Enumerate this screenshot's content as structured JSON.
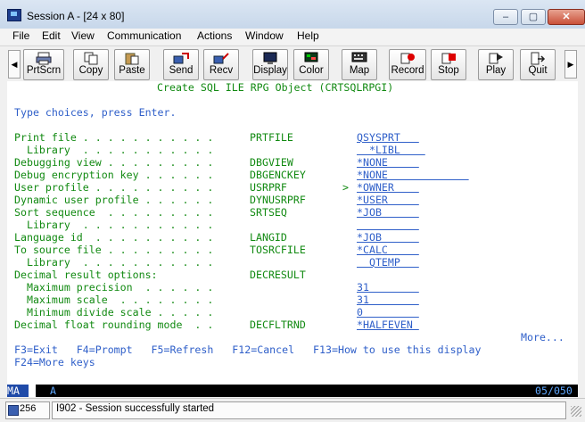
{
  "window": {
    "title": "Session A - [24 x 80]",
    "controls": [
      "–",
      "▢",
      "✕"
    ]
  },
  "menus": [
    "File",
    "Edit",
    "View",
    "Communication",
    "Actions",
    "Window",
    "Help"
  ],
  "toolbar": {
    "buttons": [
      {
        "label": "PrtScrn",
        "icon": "printer-icon"
      },
      {
        "label": "Copy",
        "icon": "copy-icon"
      },
      {
        "label": "Paste",
        "icon": "paste-icon"
      },
      {
        "label": "Send",
        "icon": "send-icon"
      },
      {
        "label": "Recv",
        "icon": "receive-icon"
      },
      {
        "label": "Display",
        "icon": "display-icon"
      },
      {
        "label": "Color",
        "icon": "color-icon"
      },
      {
        "label": "Map",
        "icon": "map-icon"
      },
      {
        "label": "Record",
        "icon": "record-icon"
      },
      {
        "label": "Stop",
        "icon": "stop-icon"
      },
      {
        "label": "Play",
        "icon": "play-icon"
      },
      {
        "label": "Quit",
        "icon": "quit-icon"
      }
    ],
    "scroll_left": "◀",
    "scroll_right": "▶"
  },
  "screen": {
    "header": "Create SQL ILE RPG Object (CRTSQLRPGI)",
    "instructions": "Type choices, press Enter.",
    "rows": [
      {
        "label": "Print file . . . . . . . . . . .",
        "keyword": "PRTFILE",
        "value": "QSYSPRT   "
      },
      {
        "label": "  Library  . . . . . . . . . . .",
        "keyword": "",
        "value": "  *LIBL    "
      },
      {
        "label": "Debugging view . . . . . . . . .",
        "keyword": "DBGVIEW",
        "value": "*NONE     "
      },
      {
        "label": "Debug encryption key . . . . . .",
        "keyword": "DBGENCKEY",
        "value": "*NONE             "
      },
      {
        "label": "User profile . . . . . . . . . .",
        "keyword": "USRPRF",
        "value": "*OWNER    ",
        "marker": ">"
      },
      {
        "label": "Dynamic user profile . . . . . .",
        "keyword": "DYNUSRPRF",
        "value": "*USER     "
      },
      {
        "label": "Sort sequence  . . . . . . . . .",
        "keyword": "SRTSEQ",
        "value": "*JOB      "
      },
      {
        "label": "  Library  . . . . . . . . . . .",
        "keyword": "",
        "value": "          "
      },
      {
        "label": "Language id  . . . . . . . . . .",
        "keyword": "LANGID",
        "value": "*JOB      "
      },
      {
        "label": "To source file . . . . . . . . .",
        "keyword": "TOSRCFILE",
        "value": "*CALC     "
      },
      {
        "label": "  Library  . . . . . . . . . . .",
        "keyword": "",
        "value": "  QTEMP   "
      },
      {
        "label": "Decimal result options:",
        "keyword": "DECRESULT",
        "value": ""
      },
      {
        "label": "  Maximum precision  . . . . . .",
        "keyword": "",
        "value": "31        "
      },
      {
        "label": "  Maximum scale  . . . . . . . .",
        "keyword": "",
        "value": "31        "
      },
      {
        "label": "  Minimum divide scale . . . . .",
        "keyword": "",
        "value": "0         "
      },
      {
        "label": "Decimal float rounding mode  . .",
        "keyword": "DECFLTRND",
        "value": "*HALFEVEN "
      }
    ],
    "more": "More...",
    "fkeys_1": "F3=Exit   F4=Prompt   F5=Refresh   F12=Cancel   F13=How to use this display",
    "fkeys_2": "F24=More keys"
  },
  "status": {
    "indicator": "MA",
    "mode": "A",
    "position": "05/050"
  },
  "message_bar": {
    "session_number": "256",
    "message": "I902 - Session successfully started"
  }
}
